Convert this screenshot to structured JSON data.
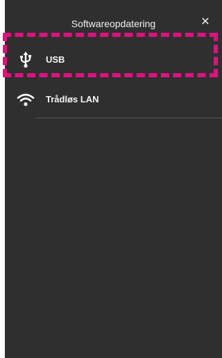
{
  "header": {
    "title": "Softwareopdatering",
    "close_glyph": "✕"
  },
  "menu": {
    "items": [
      {
        "label": "USB",
        "icon": "usb-icon"
      },
      {
        "label": "Trådløs LAN",
        "icon": "wifi-icon"
      }
    ]
  },
  "colors": {
    "background": "#2f2f2f",
    "text": "#f4f4f4",
    "highlight": "#e0107f"
  }
}
